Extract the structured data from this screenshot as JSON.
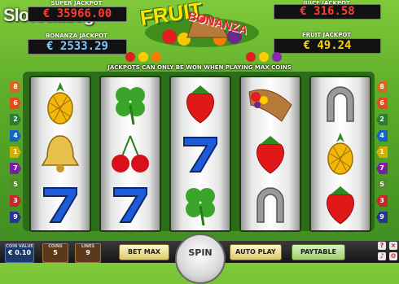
{
  "watermark": "SlotCatalog",
  "jackpots": {
    "super": {
      "label": "SUPER JACKPOT",
      "value": "€ 35966.00"
    },
    "bonanza": {
      "label": "BONANZA JACKPOT",
      "value": "€ 2533.29"
    },
    "juice": {
      "label": "JUICE JACKPOT",
      "value": "€ 316.58"
    },
    "fruit": {
      "label": "FRUIT JACKPOT",
      "value": "€ 49.24"
    }
  },
  "logo": {
    "line1": "FRUIT",
    "line2": "BONANZA"
  },
  "notice": "JACKPOTS CAN ONLY BE WON WHEN PLAYING MAX COINS",
  "reels": [
    [
      "pineapple",
      "bell",
      "seven"
    ],
    [
      "clover",
      "cherries",
      "seven"
    ],
    [
      "strawberry",
      "seven",
      "clover"
    ],
    [
      "cornucopia",
      "strawberry",
      "horseshoe"
    ],
    [
      "horseshoe",
      "pineapple",
      "strawberry"
    ]
  ],
  "paylines_left": [
    "8",
    "6",
    "2",
    "4",
    "1",
    "7",
    "5",
    "3",
    "9"
  ],
  "paylines_right": [
    "8",
    "6",
    "2",
    "4",
    "1",
    "7",
    "5",
    "3",
    "9"
  ],
  "bottom": {
    "coin_value_label": "COIN VALUE",
    "coin_value": "€ 0.10",
    "coins_label": "COINS",
    "coins": "5",
    "lines_label": "LINES",
    "lines": "9",
    "bet_max": "BET MAX",
    "spin": "SPIN",
    "auto_play": "AUTO PLAY",
    "paytable": "PAYTABLE"
  },
  "colors": {
    "accent_red": "#ff3b30",
    "accent_yellow": "#f5d400",
    "felt": "#5fae2a"
  }
}
